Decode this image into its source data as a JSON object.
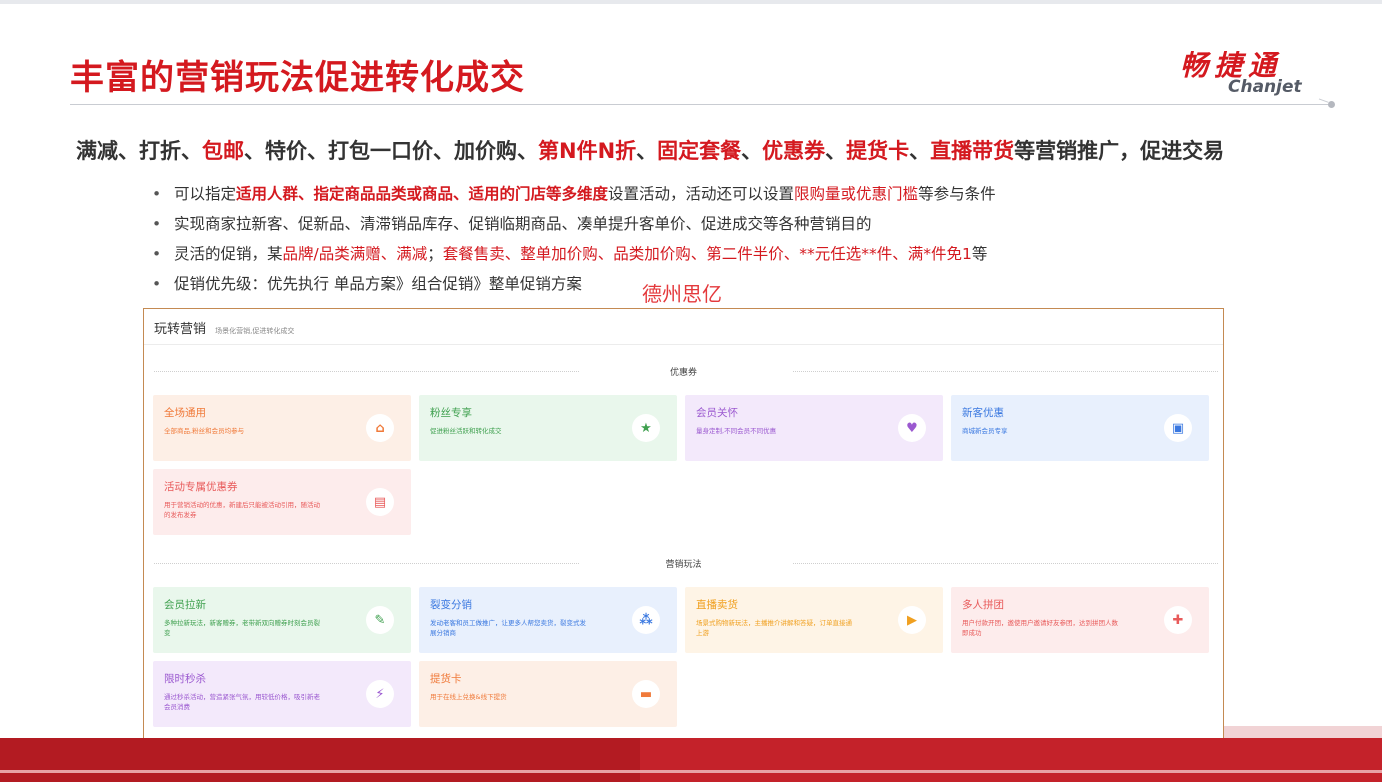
{
  "slide": {
    "title": "丰富的营销玩法促进转化成交",
    "logo_cn": "畅捷通",
    "logo_en": "Chanjet",
    "brand_red": "#d4191f"
  },
  "headline": [
    {
      "text": "满减、打折、",
      "red": false
    },
    {
      "text": "包邮",
      "red": true
    },
    {
      "text": "、特价、打包一口价、加价购、",
      "red": false
    },
    {
      "text": "第N件N折",
      "red": true
    },
    {
      "text": "、",
      "red": false
    },
    {
      "text": "固定套餐",
      "red": true
    },
    {
      "text": "、",
      "red": false
    },
    {
      "text": "优惠券",
      "red": true
    },
    {
      "text": "、",
      "red": false
    },
    {
      "text": "提货卡",
      "red": true
    },
    {
      "text": "、",
      "red": false
    },
    {
      "text": "直播带货",
      "red": true
    },
    {
      "text": "等营销推广，促进交易",
      "red": false
    }
  ],
  "bullets": [
    {
      "dot": "•",
      "segments": [
        {
          "text": "可以指定",
          "style": "plain"
        },
        {
          "text": "适用人群、指定商品品类或商品、适用的门店等多维度",
          "style": "redbold"
        },
        {
          "text": "设置活动，活动还可以设置",
          "style": "plain"
        },
        {
          "text": "限购量或优惠门槛",
          "style": "red"
        },
        {
          "text": "等参与条件",
          "style": "plain"
        }
      ]
    },
    {
      "dot": "•",
      "segments": [
        {
          "text": "实现商家拉新客、促新品、清滞销品库存、促销临期商品、凑单提升客单价、促进成交等各种营销目的",
          "style": "plain"
        }
      ]
    },
    {
      "dot": "•",
      "segments": [
        {
          "text": "灵活的促销，某",
          "style": "plain"
        },
        {
          "text": "品牌/品类满赠、满减",
          "style": "red"
        },
        {
          "text": "；",
          "style": "plain"
        },
        {
          "text": "套餐售卖、整单加价购、品类加价购、第二件半价、**元任选**件、满*件免1",
          "style": "red"
        },
        {
          "text": "等",
          "style": "plain"
        }
      ]
    },
    {
      "dot": "•",
      "segments": [
        {
          "text": "促销优先级：优先执行 单品方案》组合促销》整单促销方案",
          "style": "plain"
        }
      ]
    }
  ],
  "watermark": "德州思亿",
  "panel": {
    "title": "玩转营销",
    "subtitle": "场景化营销,促进转化成交",
    "sections": [
      {
        "label": "优惠券",
        "cards": [
          {
            "title": "全场通用",
            "desc": "全部商品,粉丝和会员均参与",
            "icon": "store-icon",
            "glyph": "⌂",
            "bg": "#fdefe6",
            "fg": "#f07a3a"
          },
          {
            "title": "粉丝专享",
            "desc": "促进粉丝活跃和转化成交",
            "icon": "star-icon",
            "glyph": "★",
            "bg": "#e9f7ec",
            "fg": "#3fa04f"
          },
          {
            "title": "会员关怀",
            "desc": "量身定制,不同会员不同优惠",
            "icon": "member-icon",
            "glyph": "♥",
            "bg": "#f3e9fb",
            "fg": "#9b59d0"
          },
          {
            "title": "新客优惠",
            "desc": "商城新会员专享",
            "icon": "ticket-icon",
            "glyph": "▣",
            "bg": "#e8f0fd",
            "fg": "#3a78e0"
          },
          {
            "title": "活动专属优惠券",
            "desc": "用于营销活动的优惠，新建后只能被活动引用，随活动的发布发券",
            "icon": "coupon-icon",
            "glyph": "▤",
            "bg": "#fdecec",
            "fg": "#e85a5a"
          }
        ]
      },
      {
        "label": "营销玩法",
        "cards": [
          {
            "title": "会员拉新",
            "desc": "多种拉新玩法，新客赠券，老带新双向赠券时刻会员裂变",
            "icon": "invite-icon",
            "glyph": "✎",
            "bg": "#e9f7ec",
            "fg": "#3fa04f"
          },
          {
            "title": "裂变分销",
            "desc": "发动老客和员工做推广，让更多人帮您卖货，裂变式发展分销商",
            "icon": "share-icon",
            "glyph": "⁂",
            "bg": "#e8f0fd",
            "fg": "#3a78e0"
          },
          {
            "title": "直播卖货",
            "desc": "场景式购物新玩法，主播推介讲解和答疑，订单直接通上游",
            "icon": "live-icon",
            "glyph": "▶",
            "bg": "#fef4e6",
            "fg": "#f0a020"
          },
          {
            "title": "多人拼团",
            "desc": "用户付款开团，邀使用户邀请好友参团，达到拼团人数即成功",
            "icon": "group-icon",
            "glyph": "✚",
            "bg": "#fdecec",
            "fg": "#e85a5a"
          },
          {
            "title": "限时秒杀",
            "desc": "通过秒杀活动，营造紧张气氛，用较低价格，吸引新老会员消费",
            "icon": "flash-icon",
            "glyph": "⚡",
            "bg": "#f3e9fb",
            "fg": "#9b59d0"
          },
          {
            "title": "提货卡",
            "desc": "用于在线上兑换&线下提货",
            "icon": "card-icon",
            "glyph": "▬",
            "bg": "#fdefe6",
            "fg": "#f07a3a"
          }
        ]
      }
    ]
  }
}
